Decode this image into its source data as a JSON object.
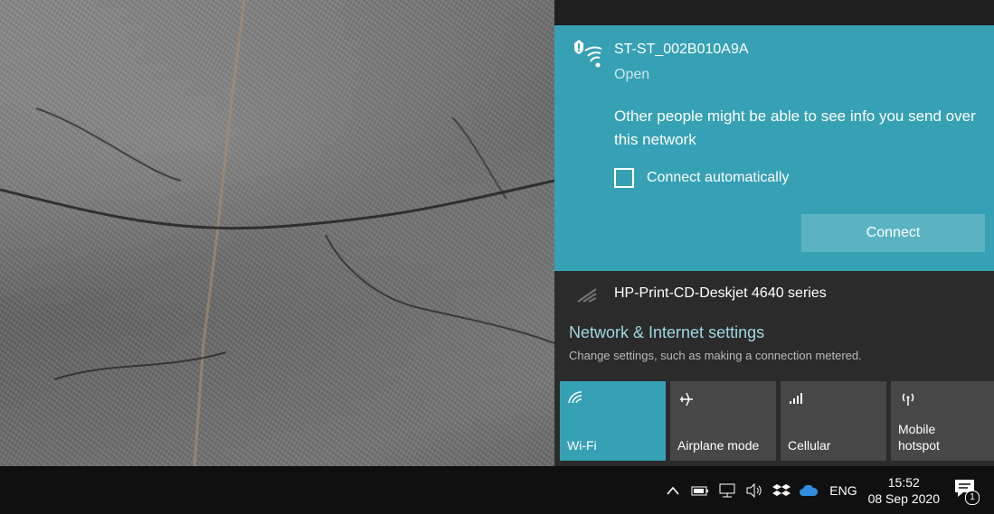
{
  "flyout": {
    "selected_network": {
      "name": "ST-ST_002B010A9A",
      "status": "Open",
      "warning": "Other people might be able to see info you send over this network",
      "auto_connect_label": "Connect automatically",
      "auto_connect_checked": false,
      "connect_label": "Connect"
    },
    "other_networks": [
      {
        "name": "HP-Print-CD-Deskjet 4640 series"
      }
    ],
    "settings_link": "Network & Internet settings",
    "settings_desc": "Change settings, such as making a connection metered.",
    "quick_actions": [
      {
        "label": "Wi-Fi",
        "icon": "wifi-icon",
        "active": true
      },
      {
        "label": "Airplane mode",
        "icon": "airplane-icon",
        "active": false
      },
      {
        "label": "Cellular",
        "icon": "signal-bars-icon",
        "active": false
      },
      {
        "label": "Mobile hotspot",
        "icon": "hotspot-icon",
        "active": false
      }
    ]
  },
  "taskbar": {
    "language": "ENG",
    "time": "15:52",
    "date": "08 Sep 2020",
    "notification_count": "1"
  },
  "colors": {
    "accent": "#36a1b4",
    "accent_button": "#5bb3c2",
    "flyout_bg": "#2b2b2b",
    "tile_bg": "#474747",
    "taskbar_bg": "#101010"
  }
}
